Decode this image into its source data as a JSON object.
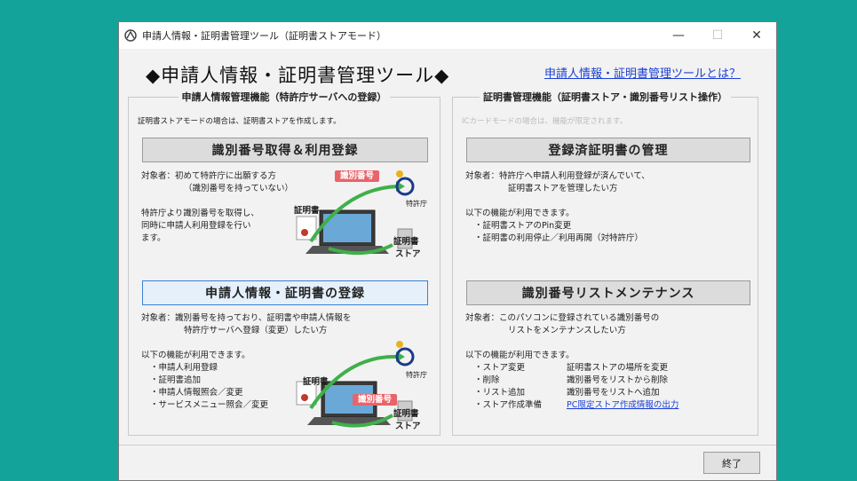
{
  "window": {
    "title": "申請人情報・証明書管理ツール（証明書ストアモード）",
    "minimize": "—",
    "maximize": "☐",
    "close": "✕"
  },
  "header": {
    "title": "◆申請人情報・証明書管理ツール◆",
    "help_link": "申請人情報・証明書管理ツールとは？"
  },
  "left_panel": {
    "title": "申請人情報管理機能（特許庁サーバへの登録）",
    "note": "証明書ストアモードの場合は、証明書ストアを作成します。",
    "section1": {
      "button": "識別番号取得＆利用登録",
      "target_line1": "対象者：初めて特許庁に出願する方",
      "target_line2": "（識別番号を持っていない）",
      "desc_line1": "特許庁より識別番号を取得し、",
      "desc_line2": "同時に申請人利用登録を行い",
      "desc_line3": "ます。",
      "illus_idnum": "識別番号",
      "illus_cert": "証明書",
      "illus_jpo": "特許庁",
      "illus_store1": "証明書",
      "illus_store2": "ストア"
    },
    "section2": {
      "button": "申請人情報・証明書の登録",
      "target_line1": "対象者：識別番号を持っており、証明書や申請人情報を",
      "target_line2": "特許庁サーバへ登録（変更）したい方",
      "features_intro": "以下の機能が利用できます。",
      "features": [
        "・申請人利用登録",
        "・証明書追加",
        "・申請人情報照会／変更",
        "・サービスメニュー照会／変更"
      ],
      "illus_idnum": "識別番号",
      "illus_cert": "証明書",
      "illus_jpo": "特許庁",
      "illus_store1": "証明書",
      "illus_store2": "ストア"
    }
  },
  "right_panel": {
    "title": "証明書管理機能（証明書ストア・識別番号リスト操作）",
    "note": "ICカードモードの場合は、機能が限定されます。",
    "section1": {
      "button": "登録済証明書の管理",
      "target_line1": "対象者：特許庁へ申請人利用登録が済んでいて、",
      "target_line2": "証明書ストアを管理したい方",
      "features_intro": "以下の機能が利用できます。",
      "features": [
        "・証明書ストアのPin変更",
        "・証明書の利用停止／利用再開（対特許庁）"
      ]
    },
    "section2": {
      "button": "識別番号リストメンテナンス",
      "target_line1": "対象者：このパソコンに登録されている識別番号の",
      "target_line2": "リストをメンテナンスしたい方",
      "features_intro": "以下の機能が利用できます。",
      "features": [
        {
          "name": "・ストア変更",
          "desc": "証明書ストアの場所を変更"
        },
        {
          "name": "・削除",
          "desc": "識別番号をリストから削除"
        },
        {
          "name": "・リスト追加",
          "desc": "識別番号をリストへ追加"
        },
        {
          "name": "・ストア作成準備",
          "desc": "PC限定ストア作成情報の出力"
        }
      ]
    }
  },
  "footer": {
    "close_button": "終了"
  },
  "colors": {
    "background": "#13a39a",
    "link": "#1b3fd6",
    "focus_border": "#3b7fd4",
    "label_red": "#e8646a"
  }
}
